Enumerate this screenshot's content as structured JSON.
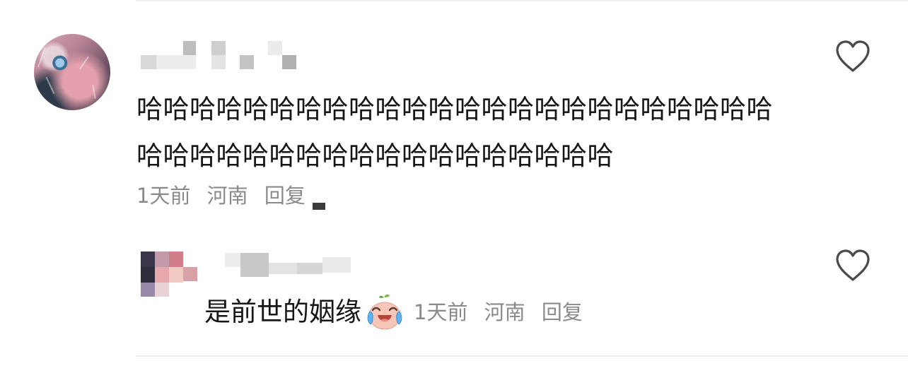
{
  "comments": [
    {
      "text": "哈哈哈哈哈哈哈哈哈哈哈哈哈哈哈哈哈哈哈哈哈哈哈哈哈哈哈哈哈哈哈哈哈哈哈哈哈哈哈哈哈哈",
      "time": "1天前",
      "location": "河南",
      "reply_label": "回复",
      "like_icon": "heart-outline-icon"
    }
  ],
  "reply": {
    "text": "是前世的姻缘",
    "emoji_icon": "crying-laughing-emoji-icon",
    "time": "1天前",
    "location": "河南",
    "reply_label": "回复",
    "like_icon": "heart-outline-icon"
  },
  "colors": {
    "text_primary": "#161616",
    "text_secondary": "#8a8a8a",
    "divider": "#efefef"
  }
}
